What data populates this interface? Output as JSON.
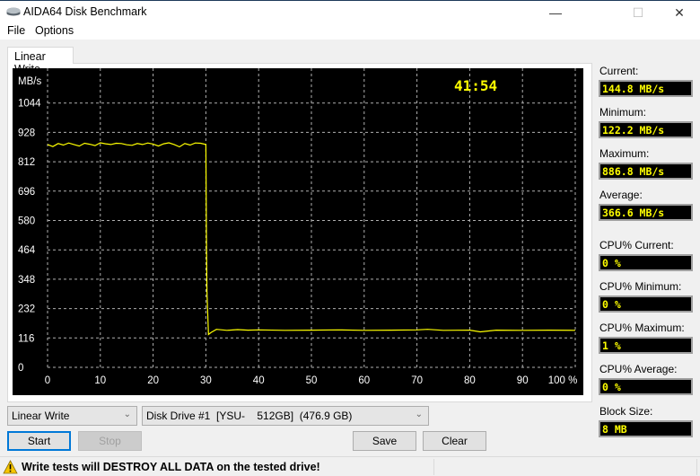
{
  "window": {
    "title": "AIDA64 Disk Benchmark",
    "minimize_glyph": "—",
    "maximize_glyph": "☐",
    "close_glyph": "✕"
  },
  "menu": {
    "items": [
      "File",
      "Options"
    ]
  },
  "tab": {
    "label": "Linear Write"
  },
  "timer": "41:54",
  "chart_data": {
    "type": "line",
    "title": "",
    "ylabel": "MB/s",
    "xlabel": "",
    "y_ticks": [
      "0",
      "116",
      "232",
      "348",
      "464",
      "580",
      "696",
      "812",
      "928",
      "1044"
    ],
    "x_ticks": [
      "0",
      "10",
      "20",
      "30",
      "40",
      "50",
      "60",
      "70",
      "80",
      "90",
      "100 %"
    ],
    "xlim": [
      0,
      100
    ],
    "ylim": [
      0,
      1160
    ],
    "grid": true,
    "line_color": "#ffff00",
    "background": "#000000",
    "series": [
      {
        "name": "Linear Write",
        "x": [
          0,
          1,
          2,
          3,
          4,
          5,
          6,
          7,
          8,
          9,
          10,
          11,
          12,
          13,
          14,
          15,
          16,
          17,
          18,
          19,
          20,
          21,
          22,
          23,
          24,
          25,
          26,
          27,
          28,
          29,
          30,
          30.1,
          30.2,
          30.5,
          31,
          32,
          34,
          36,
          38,
          40,
          45,
          50,
          55,
          60,
          65,
          70,
          72,
          75,
          80,
          82,
          85,
          90,
          95,
          100
        ],
        "values": [
          880,
          872,
          884,
          878,
          886,
          880,
          874,
          885,
          881,
          876,
          887,
          883,
          880,
          885,
          884,
          879,
          877,
          884,
          880,
          886,
          882,
          874,
          883,
          887,
          880,
          871,
          884,
          878,
          886,
          885,
          880,
          520,
          300,
          130,
          138,
          150,
          146,
          149,
          147,
          148,
          146,
          147,
          148,
          146,
          147,
          148,
          150,
          146,
          147,
          140,
          147,
          146,
          147,
          146
        ]
      }
    ]
  },
  "stats": [
    {
      "label": "Current:",
      "value": "144.8 MB/s"
    },
    {
      "label": "Minimum:",
      "value": "122.2 MB/s"
    },
    {
      "label": "Maximum:",
      "value": "886.8 MB/s"
    },
    {
      "label": "Average:",
      "value": "366.6 MB/s"
    },
    {
      "label": "CPU% Current:",
      "value": "0 %"
    },
    {
      "label": "CPU% Minimum:",
      "value": "0 %"
    },
    {
      "label": "CPU% Maximum:",
      "value": "1 %"
    },
    {
      "label": "CPU% Average:",
      "value": "0 %"
    },
    {
      "label": "Block Size:",
      "value": "8 MB"
    }
  ],
  "controls": {
    "test_select": "Linear Write",
    "drive_select": "Disk Drive #1  [YSU-    512GB]  (476.9 GB)",
    "start": "Start",
    "stop": "Stop",
    "save": "Save",
    "clear": "Clear"
  },
  "status": {
    "warning": "Write tests will DESTROY ALL DATA on the tested drive!"
  }
}
